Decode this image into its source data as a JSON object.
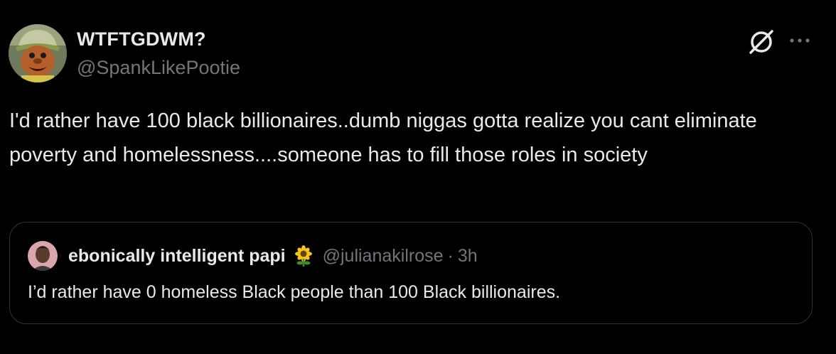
{
  "tweet": {
    "author": {
      "display_name": "WTFTGDWM?",
      "handle": "@SpankLikePootie",
      "avatar_icon": "muppet-avatar"
    },
    "actions": {
      "grok_icon": "grok-icon",
      "more_icon": "more-icon"
    },
    "text": "I'd rather have 100 black billionaires..dumb niggas gotta realize you cant eliminate poverty and homelessness....someone has to fill those roles in society",
    "quote": {
      "display_name": "ebonically intelligent papi",
      "emoji_icon": "sunflower-icon",
      "handle": "@julianakilrose",
      "separator": "·",
      "time": "3h",
      "text": "I’d rather have 0 homeless Black people than 100 Black billionaires."
    }
  },
  "colors": {
    "background": "#000000",
    "primary_text": "#e7e9ea",
    "secondary_text": "#71767b",
    "border": "#2f3336"
  }
}
